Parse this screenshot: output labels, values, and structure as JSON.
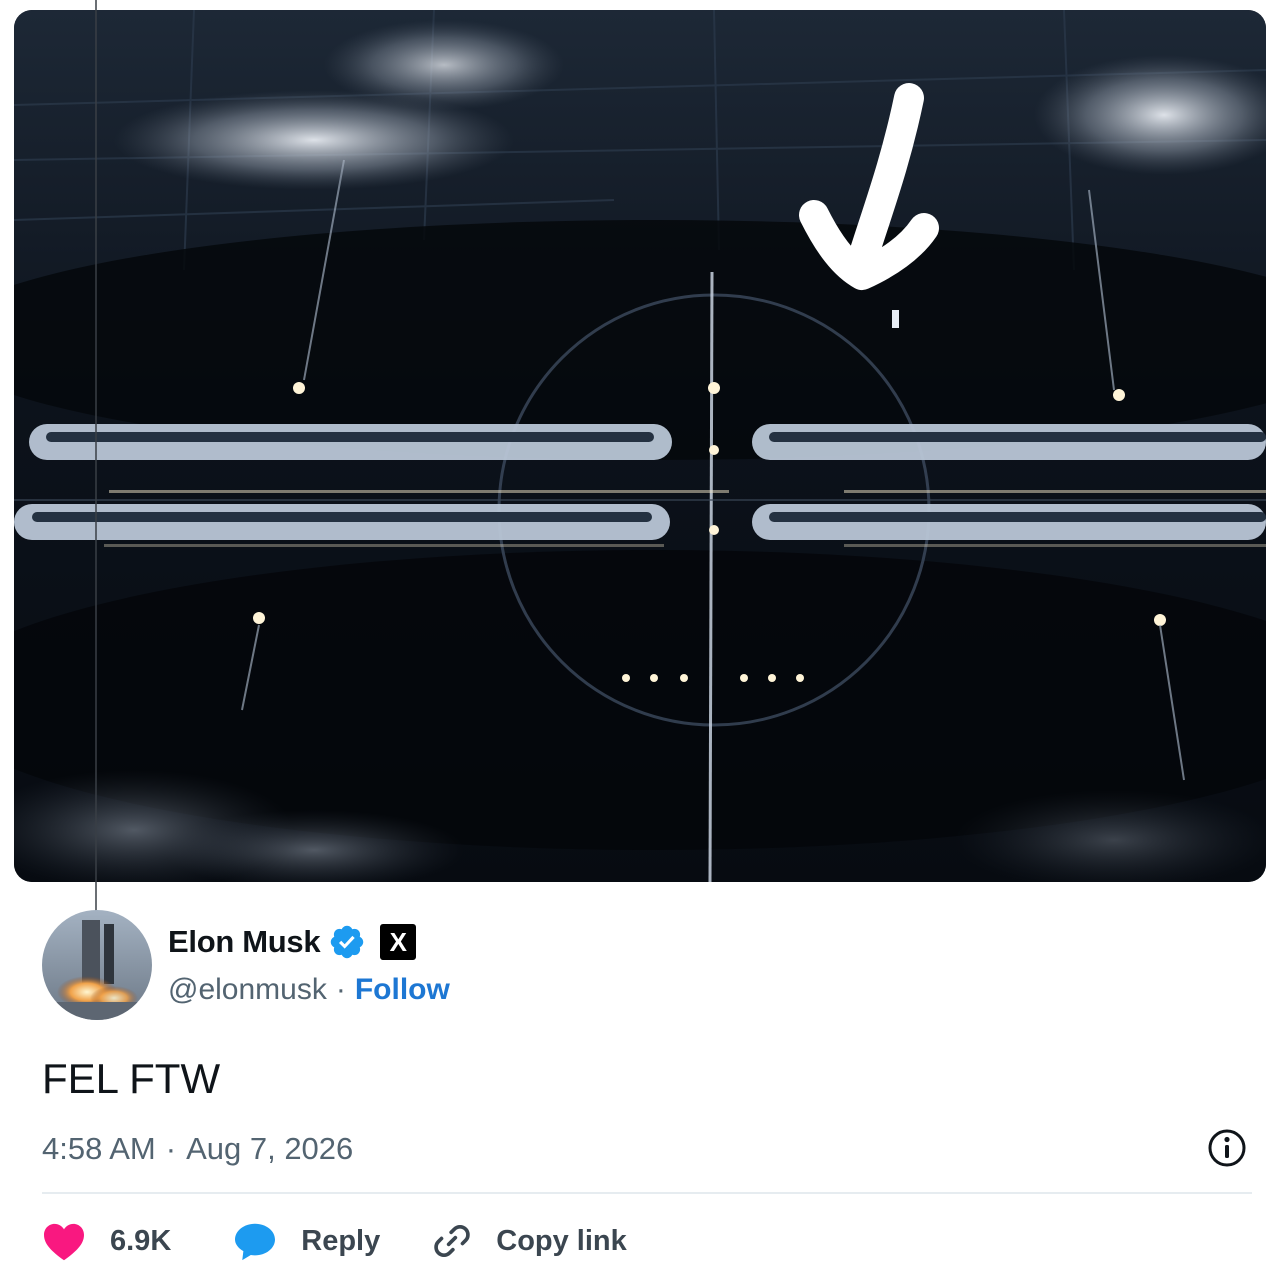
{
  "tweet": {
    "author": {
      "name": "Elon Musk",
      "handle": "@elonmusk",
      "separator": "·",
      "follow_label": "Follow",
      "verified_color": "#1d9bf0",
      "platform_logo": "X"
    },
    "text": "FEL FTW",
    "time": "4:58 AM",
    "date_separator": "·",
    "date": "Aug 7, 2026",
    "media": {
      "icon": "aerial-night-photo-with-handdrawn-checkmark"
    }
  },
  "actions": {
    "like_count": "6.9K",
    "like_color": "#f91880",
    "reply_label": "Reply",
    "reply_color": "#1d9bf0",
    "copy_label": "Copy link"
  },
  "icons": {
    "info": "info-icon",
    "like": "heart-icon",
    "reply": "speech-bubble-icon",
    "copy": "link-icon"
  }
}
